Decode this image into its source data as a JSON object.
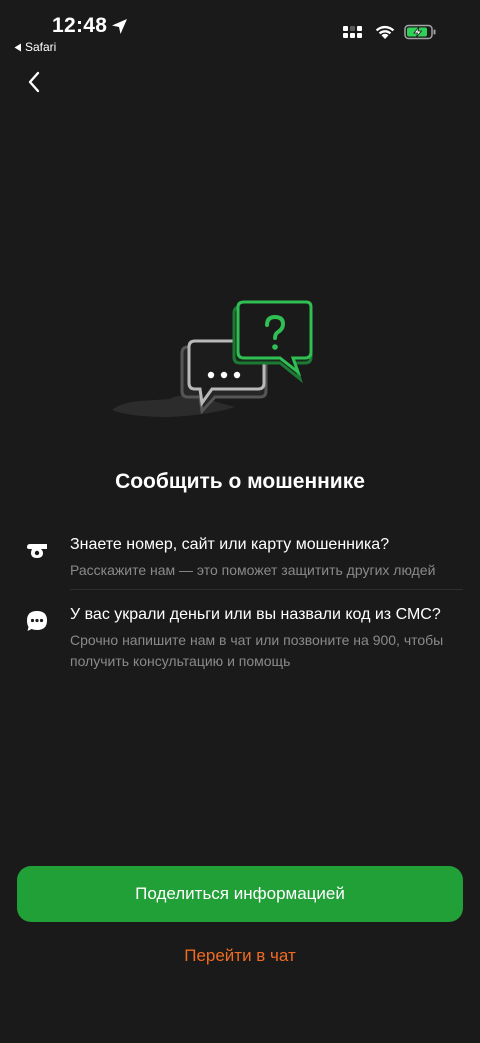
{
  "status_bar": {
    "time": "12:48",
    "back_app": "Safari"
  },
  "colors": {
    "background": "#1a1a1a",
    "accent_green": "#21a038",
    "link_orange": "#f06b22",
    "secondary_text": "#8a8a8a"
  },
  "page": {
    "title": "Сообщить о мошеннике"
  },
  "items": [
    {
      "icon": "whistle-icon",
      "title": "Знаете номер, сайт или карту мошенника?",
      "subtitle": "Расскажите нам — это поможет защитить других людей"
    },
    {
      "icon": "chat-bubble-icon",
      "title": "У вас украли деньги или вы назвали код из СМС?",
      "subtitle": "Срочно напишите нам в чат или позвоните на 900, чтобы получить консультацию и помощь"
    }
  ],
  "actions": {
    "primary": "Поделиться информацией",
    "secondary": "Перейти в чат"
  }
}
